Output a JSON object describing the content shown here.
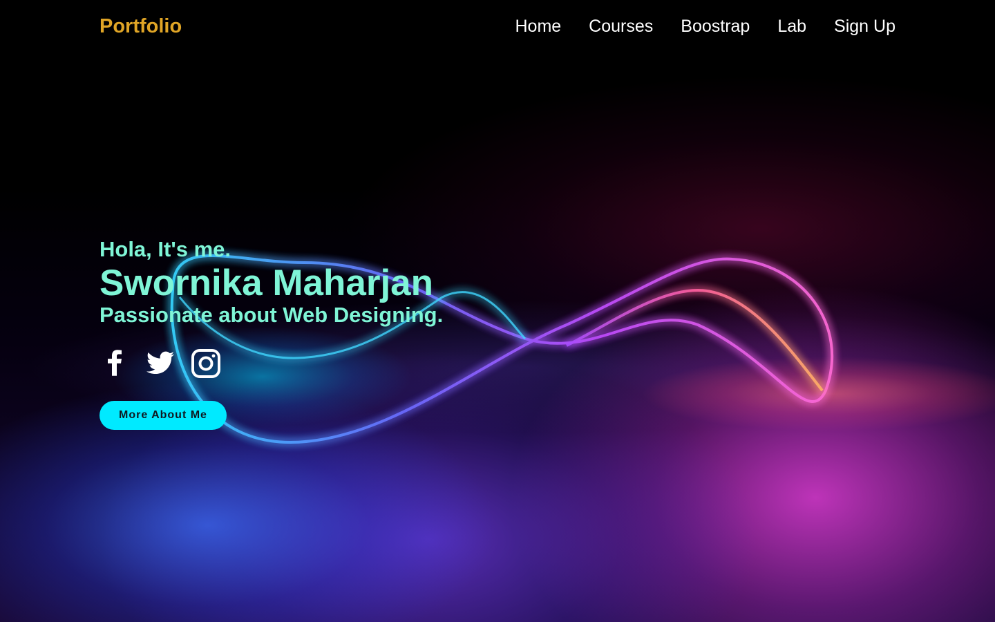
{
  "header": {
    "brand": "Portfolio",
    "nav": [
      {
        "label": "Home"
      },
      {
        "label": "Courses"
      },
      {
        "label": "Boostrap"
      },
      {
        "label": "Lab"
      },
      {
        "label": "Sign Up"
      }
    ]
  },
  "hero": {
    "greeting": "Hola, It's me.",
    "name": "Swornika Maharjan",
    "tagline": "Passionate about Web Designing.",
    "socials": [
      {
        "icon": "facebook-icon"
      },
      {
        "icon": "twitter-icon"
      },
      {
        "icon": "instagram-icon"
      }
    ],
    "cta_label": "More About Me"
  },
  "colors": {
    "brand": "#e0a526",
    "hero_text": "#7ff5d6",
    "cta_bg": "#00eaff",
    "background": "#000000"
  }
}
